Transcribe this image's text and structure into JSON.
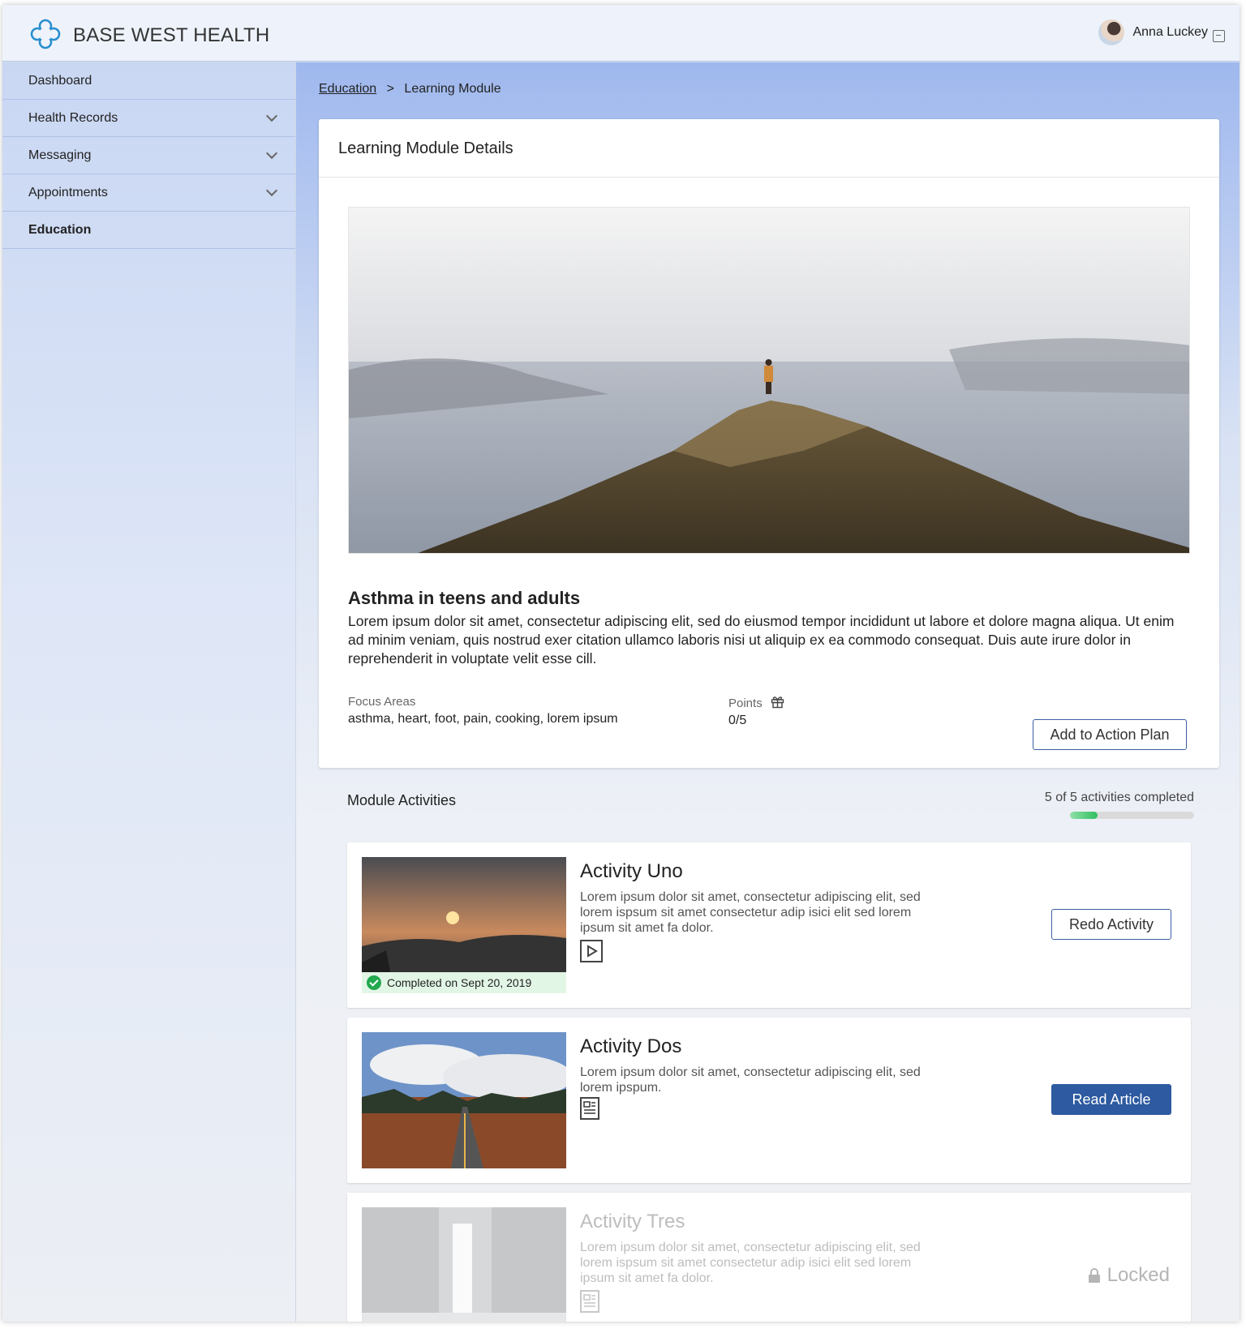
{
  "header": {
    "brand": "BASE WEST HEALTH",
    "user_name": "Anna Luckey"
  },
  "sidebar": {
    "items": [
      {
        "label": "Dashboard",
        "expandable": false,
        "active": false
      },
      {
        "label": "Health Records",
        "expandable": true,
        "active": false
      },
      {
        "label": "Messaging",
        "expandable": true,
        "active": false
      },
      {
        "label": "Appointments",
        "expandable": true,
        "active": false
      },
      {
        "label": "Education",
        "expandable": false,
        "active": true
      }
    ]
  },
  "breadcrumb": {
    "parent": "Education",
    "separator": ">",
    "current": "Learning Module"
  },
  "details": {
    "card_title": "Learning Module Details",
    "module_title": "Asthma in teens and adults",
    "description": "Lorem ipsum dolor sit amet, consectetur adipiscing elit, sed do eiusmod tempor incididunt ut labore et dolore magna aliqua. Ut enim ad minim veniam, quis nostrud exer citation ullamco laboris nisi ut aliquip ex ea commodo consequat. Duis aute irure dolor in reprehenderit in voluptate velit esse cill.",
    "focus_label": "Focus Areas",
    "focus_value": "asthma, heart, foot, pain, cooking, lorem ipsum",
    "points_label": "Points",
    "points_value": "0/5",
    "add_button": "Add to Action Plan"
  },
  "activities": {
    "title": "Module Activities",
    "progress_text": "5 of 5 activities completed",
    "progress_fraction": 0.22,
    "items": [
      {
        "title": "Activity Uno",
        "description": "Lorem ipsum dolor sit amet, consectetur adipiscing elit, sed lorem ispsum sit amet consectetur adip isici elit sed lorem ipsum sit amet fa dolor.",
        "type_icon": "video-play-icon",
        "completed_text": "Completed on Sept 20, 2019",
        "action": "Redo Activity"
      },
      {
        "title": "Activity Dos",
        "description": "Lorem ipsum dolor sit amet, consectetur adipiscing elit, sed lorem ipspum.",
        "type_icon": "article-icon",
        "action": "Read Article"
      },
      {
        "title": "Activity Tres",
        "description": "Lorem ipsum dolor sit amet, consectetur adipiscing elit, sed lorem ispsum sit amet consectetur adip isici elit sed lorem ipsum sit amet fa dolor.",
        "type_icon": "article-icon",
        "status": "Locked"
      }
    ]
  },
  "colors": {
    "primary": "#2d5aa0",
    "accent_logo": "#2a8fcf",
    "success": "#22a94f"
  }
}
